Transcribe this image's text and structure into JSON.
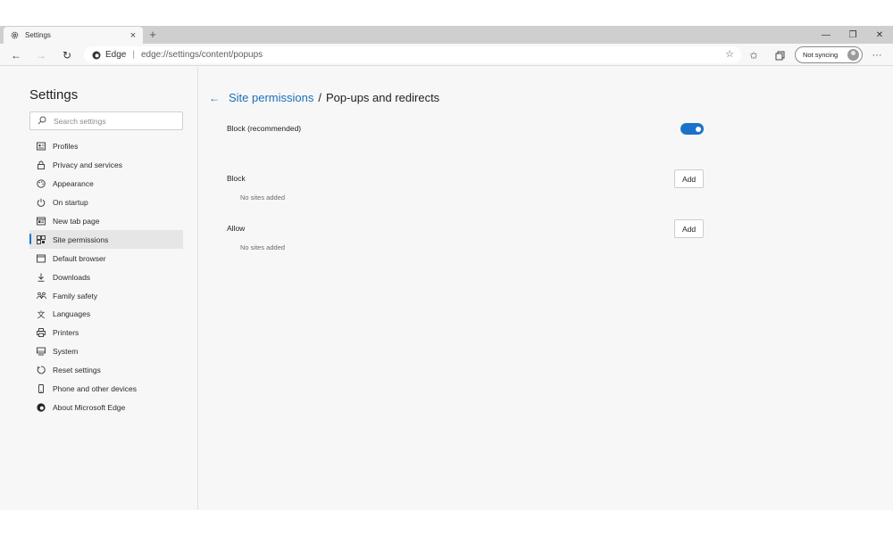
{
  "tab": {
    "title": "Settings"
  },
  "toolbar": {
    "brand": "Edge",
    "separator": "|",
    "url": "edge://settings/content/popups",
    "sync_label": "Not syncing"
  },
  "sidebar": {
    "title": "Settings",
    "search_placeholder": "Search settings",
    "items": [
      {
        "label": "Profiles",
        "icon": "profile-card-icon"
      },
      {
        "label": "Privacy and services",
        "icon": "lock-icon"
      },
      {
        "label": "Appearance",
        "icon": "palette-icon"
      },
      {
        "label": "On startup",
        "icon": "power-icon"
      },
      {
        "label": "New tab page",
        "icon": "new-tab-icon"
      },
      {
        "label": "Site permissions",
        "icon": "site-permissions-icon",
        "active": true
      },
      {
        "label": "Default browser",
        "icon": "browser-window-icon"
      },
      {
        "label": "Downloads",
        "icon": "download-icon"
      },
      {
        "label": "Family safety",
        "icon": "family-icon"
      },
      {
        "label": "Languages",
        "icon": "language-icon"
      },
      {
        "label": "Printers",
        "icon": "printer-icon"
      },
      {
        "label": "System",
        "icon": "computer-icon"
      },
      {
        "label": "Reset settings",
        "icon": "reset-icon"
      },
      {
        "label": "Phone and other devices",
        "icon": "phone-icon"
      },
      {
        "label": "About Microsoft Edge",
        "icon": "edge-logo-icon"
      }
    ]
  },
  "main": {
    "breadcrumb_parent": "Site permissions",
    "breadcrumb_sep": "/",
    "breadcrumb_current": "Pop-ups and redirects",
    "block_recommended_label": "Block (recommended)",
    "block_recommended_on": true,
    "block": {
      "label": "Block",
      "add_label": "Add",
      "empty_text": "No sites added"
    },
    "allow": {
      "label": "Allow",
      "add_label": "Add",
      "empty_text": "No sites added"
    }
  },
  "colors": {
    "accent": "#1a73c9",
    "link": "#1a6fb8"
  }
}
